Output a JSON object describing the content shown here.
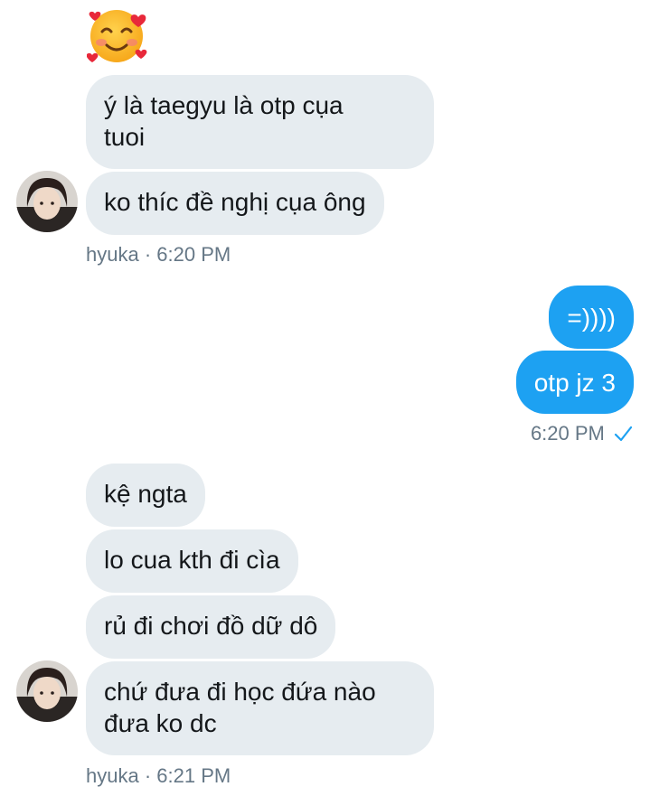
{
  "thread": {
    "reaction_emoji": "smiling-face-with-hearts",
    "group1": {
      "messages": [
        "ý là taegyu là otp cụa\ntuoi",
        "ko thíc đề nghị cụa ông"
      ],
      "sender": "hyuka",
      "separator": "·",
      "time": "6:20 PM"
    },
    "group2": {
      "messages": [
        "=))))",
        "otp jz 3"
      ],
      "time": "6:20 PM",
      "status_icon": "check-icon"
    },
    "group3": {
      "messages": [
        "kệ ngta",
        "lo cua kth đi cìa",
        "rủ đi chơi đồ dữ dô",
        "chứ đưa đi học đứa nào\nđưa ko dc"
      ],
      "sender": "hyuka",
      "separator": "·",
      "time": "6:21 PM"
    }
  },
  "colors": {
    "incoming_bubble": "#e6ecf0",
    "outgoing_bubble": "#1da1f2",
    "meta_text": "#657786",
    "check": "#1da1f2"
  }
}
